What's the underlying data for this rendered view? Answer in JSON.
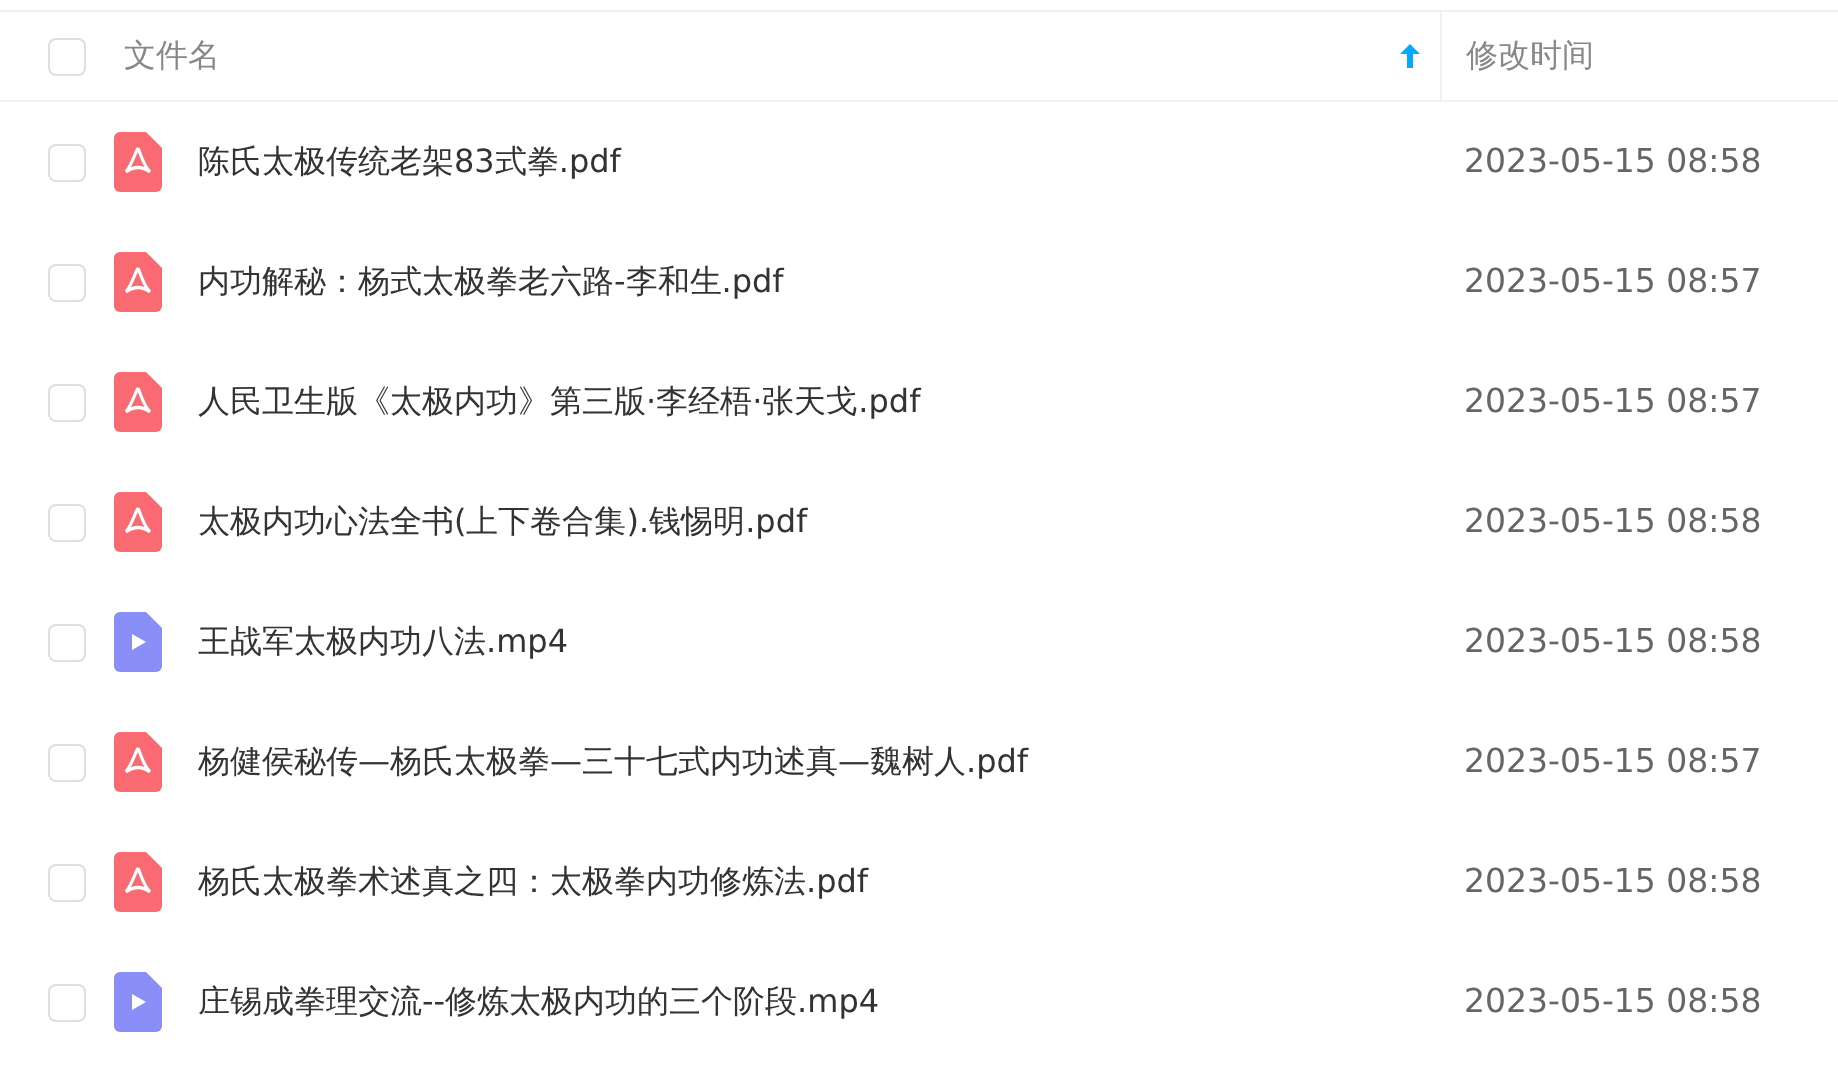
{
  "header": {
    "checked": false,
    "name_label": "文件名",
    "sort_ascending": true,
    "time_label": "修改时间"
  },
  "rows": [
    {
      "kind": "pdf",
      "name": "陈氏太极传统老架83式拳.pdf",
      "time": "2023-05-15 08:58",
      "checked": false
    },
    {
      "kind": "pdf",
      "name": "内功解秘：杨式太极拳老六路-李和生.pdf",
      "time": "2023-05-15 08:57",
      "checked": false
    },
    {
      "kind": "pdf",
      "name": "人民卫生版《太极内功》第三版·李经梧·张天戈.pdf",
      "time": "2023-05-15 08:57",
      "checked": false
    },
    {
      "kind": "pdf",
      "name": "太极内功心法全书(上下卷合集).钱惕明.pdf",
      "time": "2023-05-15 08:58",
      "checked": false
    },
    {
      "kind": "video",
      "name": "王战军太极内功八法.mp4",
      "time": "2023-05-15 08:58",
      "checked": false
    },
    {
      "kind": "pdf",
      "name": "杨健侯秘传—杨氏太极拳—三十七式内功述真—魏树人.pdf",
      "time": "2023-05-15 08:57",
      "checked": false
    },
    {
      "kind": "pdf",
      "name": "杨氏太极拳术述真之四：太极拳内功修炼法.pdf",
      "time": "2023-05-15 08:58",
      "checked": false
    },
    {
      "kind": "video",
      "name": "庄锡成拳理交流--修炼太极内功的三个阶段.mp4",
      "time": "2023-05-15 08:58",
      "checked": false
    }
  ]
}
